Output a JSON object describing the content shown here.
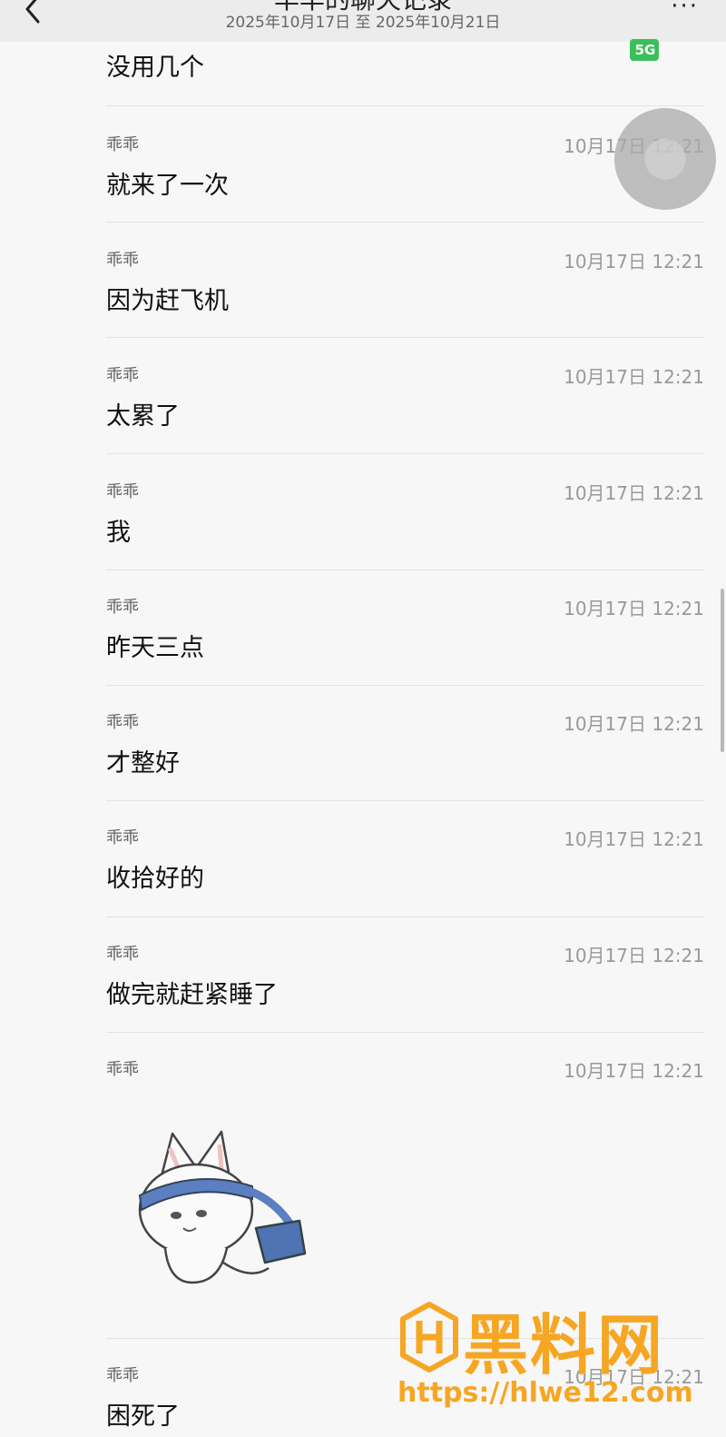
{
  "header": {
    "title": "华华的聊天记录",
    "date_range": "2025年10月17日 至 2025年10月21日",
    "more_label": "···"
  },
  "status": {
    "network_badge": "5G"
  },
  "partial_message": {
    "text": "没用几个"
  },
  "messages": [
    {
      "sender": "乖乖",
      "time": "10月17日 12:21",
      "text": "就来了一次"
    },
    {
      "sender": "乖乖",
      "time": "10月17日 12:21",
      "text": "因为赶飞机"
    },
    {
      "sender": "乖乖",
      "time": "10月17日 12:21",
      "text": "太累了"
    },
    {
      "sender": "乖乖",
      "time": "10月17日 12:21",
      "text": "我"
    },
    {
      "sender": "乖乖",
      "time": "10月17日 12:21",
      "text": "昨天三点"
    },
    {
      "sender": "乖乖",
      "time": "10月17日 12:21",
      "text": "才整好"
    },
    {
      "sender": "乖乖",
      "time": "10月17日 12:21",
      "text": "收拾好的"
    },
    {
      "sender": "乖乖",
      "time": "10月17日 12:21",
      "text": "做完就赶紧睡了"
    },
    {
      "sender": "乖乖",
      "time": "10月17日 12:21",
      "sticker": "cat-with-headband-sticker"
    },
    {
      "sender": "乖乖",
      "time": "10月17日 12:21",
      "text": "困死了"
    }
  ],
  "watermark": {
    "title": "黑料网",
    "url": "https://hlwe12.com"
  },
  "colors": {
    "accent_watermark": "#f6a623",
    "badge_green": "#3cbf5a"
  }
}
